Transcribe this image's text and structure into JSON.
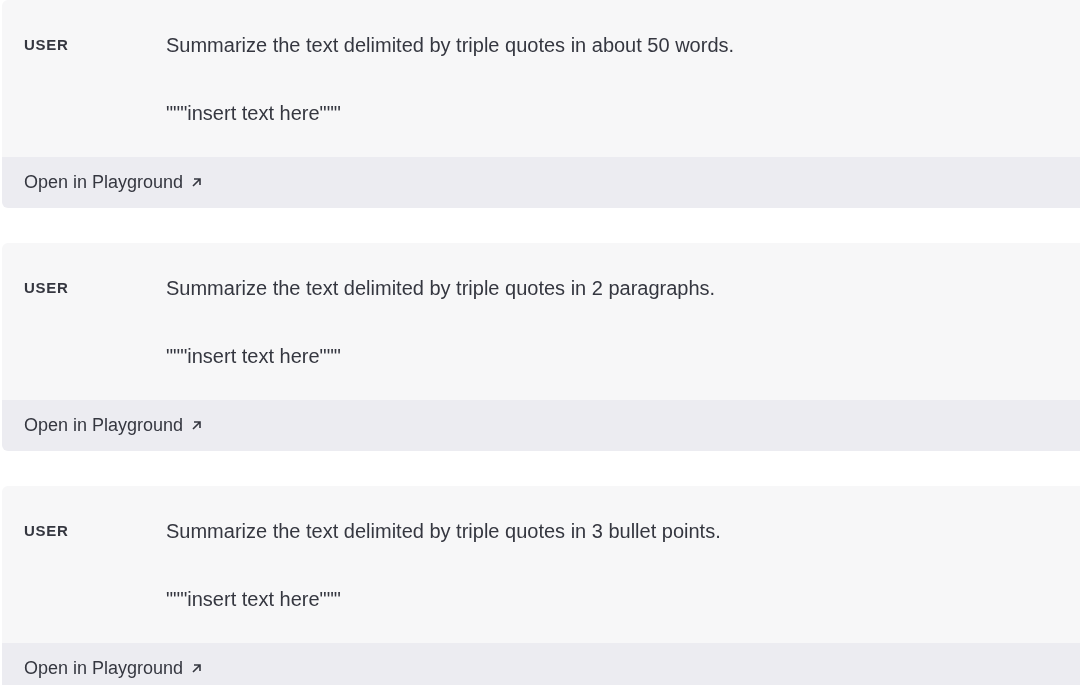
{
  "examples": [
    {
      "role": "USER",
      "lines": [
        "Summarize the text delimited by triple quotes in about 50 words.",
        "\"\"\"insert text here\"\"\""
      ],
      "link": "Open in Playground"
    },
    {
      "role": "USER",
      "lines": [
        "Summarize the text delimited by triple quotes in 2 paragraphs.",
        "\"\"\"insert text here\"\"\""
      ],
      "link": "Open in Playground"
    },
    {
      "role": "USER",
      "lines": [
        "Summarize the text delimited by triple quotes in 3 bullet points.",
        "\"\"\"insert text here\"\"\""
      ],
      "link": "Open in Playground"
    }
  ]
}
